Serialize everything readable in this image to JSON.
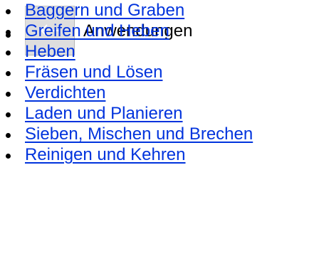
{
  "header": {
    "back_icon": "arrow-left-icon",
    "title": "Anwendungen"
  },
  "menu": {
    "items": [
      {
        "label": "Baggern und Graben"
      },
      {
        "label": "Greifen und Heben"
      },
      {
        "label": "Heben"
      },
      {
        "label": "Fräsen und Lösen"
      },
      {
        "label": "Verdichten"
      },
      {
        "label": "Laden und Planieren"
      },
      {
        "label": "Sieben, Mischen und Brechen"
      },
      {
        "label": "Reinigen und Kehren"
      }
    ]
  },
  "colors": {
    "link": "#0033dd",
    "button_bg": "#dedede",
    "icon": "#ffffff"
  }
}
